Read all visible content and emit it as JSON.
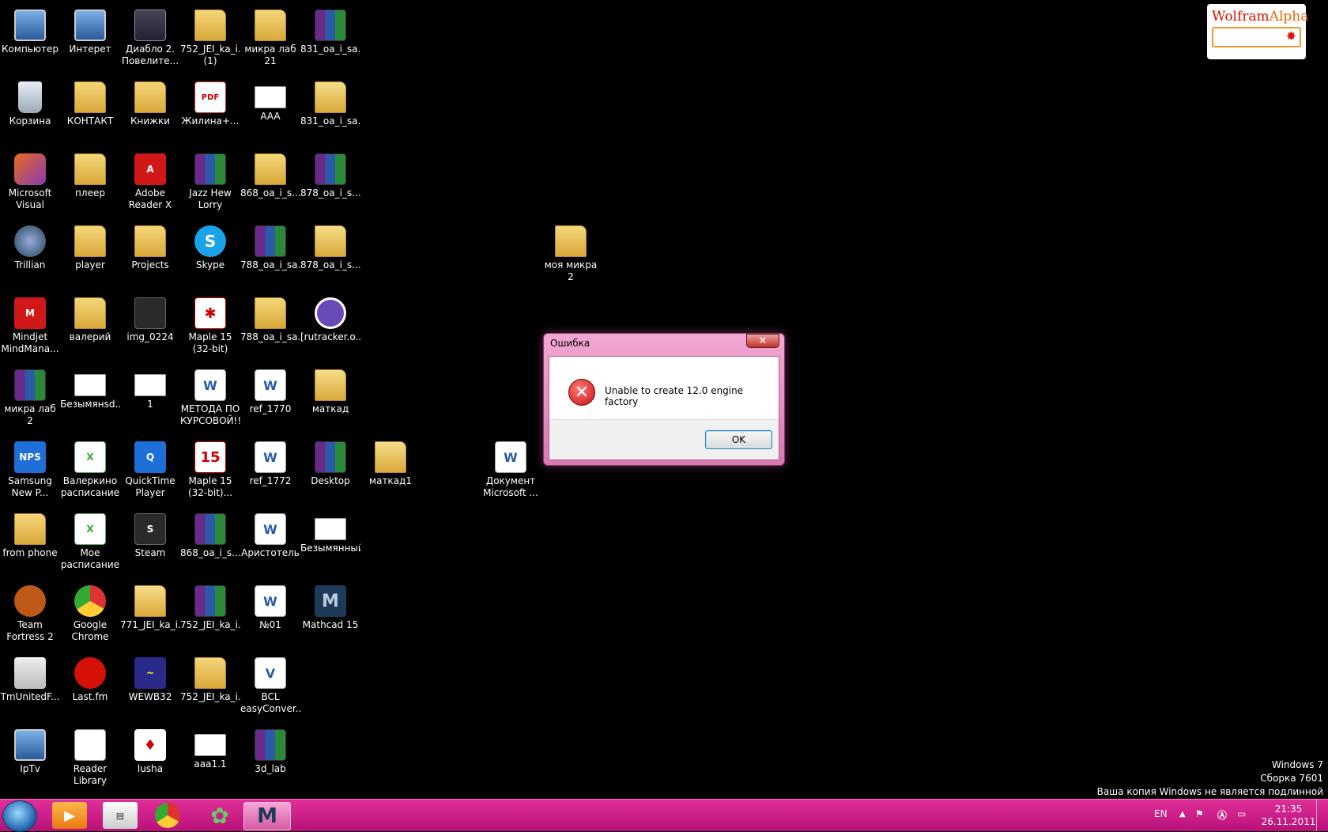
{
  "desktop_icons": [
    {
      "label": "Компьютер",
      "kind": "computer"
    },
    {
      "label": "Корзина",
      "kind": "bin"
    },
    {
      "label": "Microsoft\nVisual Stud...",
      "kind": "vs"
    },
    {
      "label": "Trillian",
      "kind": "trillian"
    },
    {
      "label": "Mindjet\nMindMana...",
      "kind": "red",
      "glyph": "M"
    },
    {
      "label": "микра лаб 2",
      "kind": "rar"
    },
    {
      "label": "Samsung\nNew P...",
      "kind": "blue",
      "glyph": "NPS"
    },
    {
      "label": "from phone",
      "kind": "folder"
    },
    {
      "label": "Team\nFortress 2",
      "kind": "orange"
    },
    {
      "label": "TmUnitedF...",
      "kind": "strip"
    },
    {
      "label": "IpTv",
      "kind": "computer"
    },
    {
      "label": "Интерет",
      "kind": "computer"
    },
    {
      "label": "КОНТАКТ",
      "kind": "folder"
    },
    {
      "label": "плеер",
      "kind": "folder"
    },
    {
      "label": "player",
      "kind": "folder"
    },
    {
      "label": "валерий",
      "kind": "folder"
    },
    {
      "label": "Безымянsd...",
      "kind": "img"
    },
    {
      "label": "Валеркино\nрасписание",
      "kind": "sheet",
      "glyph": "X"
    },
    {
      "label": "Мое\nрасписание",
      "kind": "sheet",
      "glyph": "X"
    },
    {
      "label": "Google\nChrome",
      "kind": "chrome"
    },
    {
      "label": "Last.fm",
      "kind": "lastfm"
    },
    {
      "label": "Reader\nLibrary",
      "kind": "book"
    },
    {
      "label": "Диабло 2.\nПовелите...",
      "kind": "skull"
    },
    {
      "label": "Книжки",
      "kind": "folder"
    },
    {
      "label": "Adobe\nReader X",
      "kind": "red",
      "glyph": "A"
    },
    {
      "label": "Projects",
      "kind": "folder"
    },
    {
      "label": "img_0224",
      "kind": "dark"
    },
    {
      "label": "1",
      "kind": "img"
    },
    {
      "label": "QuickTime\nPlayer",
      "kind": "blue",
      "glyph": "Q"
    },
    {
      "label": "Steam",
      "kind": "dark",
      "glyph": "S"
    },
    {
      "label": "771_JEI_ka_i...",
      "kind": "folder-doc"
    },
    {
      "label": "WEWB32",
      "kind": "wave",
      "glyph": "~"
    },
    {
      "label": "lusha",
      "kind": "lusha",
      "glyph": "♦"
    },
    {
      "label": "752_JEI_ka_i...\n(1)",
      "kind": "folder"
    },
    {
      "label": "Жилина+...",
      "kind": "pdf",
      "glyph": "PDF"
    },
    {
      "label": "Jazz Hew\nLorry",
      "kind": "rar"
    },
    {
      "label": "Skype",
      "kind": "skype",
      "glyph": "S"
    },
    {
      "label": "Maple 15\n(32-bit)",
      "kind": "maple",
      "glyph": "✱"
    },
    {
      "label": "МЕТОДА ПО\nКУРСОВОЙ!!!",
      "kind": "word",
      "glyph": "W"
    },
    {
      "label": "Maple 15\n(32-bit)...",
      "kind": "maple",
      "glyph": "15"
    },
    {
      "label": "868_oa_i_s...",
      "kind": "rar"
    },
    {
      "label": "752_JEI_ka_i...",
      "kind": "rar"
    },
    {
      "label": "752_JEI_ka_i...",
      "kind": "folder"
    },
    {
      "label": "aaa1.1",
      "kind": "img"
    },
    {
      "label": "микра лаб\n21",
      "kind": "folder"
    },
    {
      "label": "AAA",
      "kind": "img"
    },
    {
      "label": "868_oa_i_s...",
      "kind": "folder"
    },
    {
      "label": "788_oa_i_sa...",
      "kind": "rar"
    },
    {
      "label": "788_oa_i_sa...",
      "kind": "folder"
    },
    {
      "label": "ref_1770",
      "kind": "word",
      "glyph": "W"
    },
    {
      "label": "ref_1772",
      "kind": "word",
      "glyph": "W"
    },
    {
      "label": "Аристотель",
      "kind": "word",
      "glyph": "W"
    },
    {
      "label": "№01",
      "kind": "word",
      "glyph": "W"
    },
    {
      "label": "BCL\neasyConver...",
      "kind": "word",
      "glyph": "V"
    },
    {
      "label": "3d_lab",
      "kind": "rar"
    },
    {
      "label": "831_oa_i_sa...",
      "kind": "rar"
    },
    {
      "label": "831_oa_i_sa...",
      "kind": "folder-doc"
    },
    {
      "label": "878_oa_i_s...",
      "kind": "rar"
    },
    {
      "label": "878_oa_i_s...",
      "kind": "folder-doc"
    },
    {
      "label": "[rutracker.o...",
      "kind": "torrent"
    },
    {
      "label": "маткад",
      "kind": "folder-doc"
    },
    {
      "label": "Desktop",
      "kind": "rar"
    },
    {
      "label": "Безымянный",
      "kind": "img"
    },
    {
      "label": "Mathcad 15",
      "kind": "mathcad",
      "glyph": "M"
    },
    {
      "label": "маткад1",
      "kind": "folder-doc"
    },
    {
      "label": "Документ\nMicrosoft ...",
      "kind": "word",
      "glyph": "W"
    },
    {
      "label": "моя микра 2",
      "kind": "folder"
    }
  ],
  "wolfram_widget": {
    "brand_a": "Wolfram",
    "brand_b": "Alpha",
    "input_value": ""
  },
  "dialog": {
    "title": "Ошибка",
    "close_glyph": "✕",
    "error_glyph": "✕",
    "message": "Unable to create 12.0 engine factory",
    "ok_label": "OK"
  },
  "watermark": {
    "line1": "Windows 7",
    "line2": "Сборка 7601",
    "line3": "Ваша копия Windows не является подлинной"
  },
  "taskbar": {
    "pinned": [
      "media-player",
      "tm-united",
      "google-chrome",
      "icq",
      "mathcad"
    ],
    "language": "EN",
    "time": "21:35",
    "date": "26.11.2011"
  },
  "colors": {
    "taskbar": "#c81888",
    "dialog_frame": "#e58cc0",
    "background": "#000000"
  }
}
